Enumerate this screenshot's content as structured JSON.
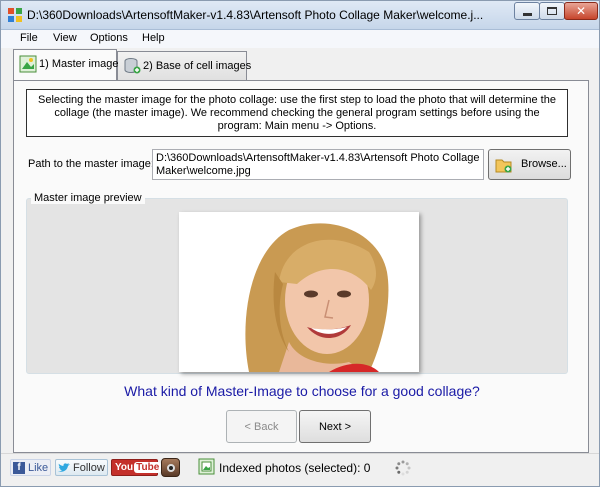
{
  "window": {
    "title": "D:\\360Downloads\\ArtensoftMaker-v1.4.83\\Artensoft Photo Collage Maker\\welcome.j..."
  },
  "menu": {
    "file": "File",
    "view": "View",
    "options": "Options",
    "help": "Help"
  },
  "tabs": [
    {
      "label": "1) Master image",
      "active": true
    },
    {
      "label": "2) Base of cell images",
      "active": false
    }
  ],
  "info_text": "Selecting the master image for the photo collage: use the first step to load the photo that will determine the collage (the master image). We recommend checking the general program settings before using the program: Main menu -> Options.",
  "path": {
    "label": "Path to the master image:",
    "value": "D:\\360Downloads\\ArtensoftMaker-v1.4.83\\Artensoft Photo Collage Maker\\welcome.jpg",
    "browse_label": "Browse..."
  },
  "preview": {
    "caption": "Master image preview"
  },
  "help_link": "What kind of Master-Image to choose for a good collage?",
  "nav": {
    "back_label": "< Back",
    "next_label": "Next >"
  },
  "statusbar": {
    "fb_like": "Like",
    "tw_follow": "Follow",
    "yt_you": "You",
    "yt_tube": "Tube",
    "indexed_label": "Indexed photos (selected): 0"
  },
  "colors": {
    "link": "#1a1aa6",
    "titlebar": "#c6d6ea",
    "close_button": "#c7452c"
  }
}
